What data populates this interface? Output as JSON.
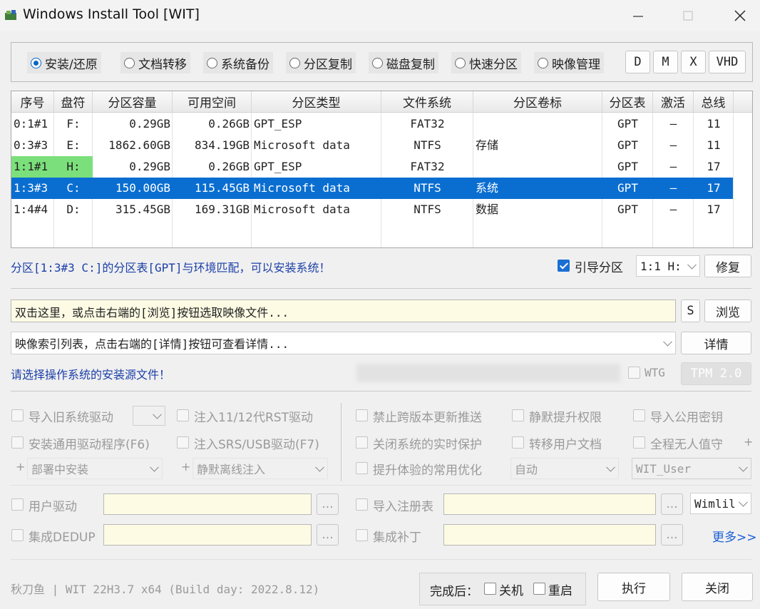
{
  "window": {
    "title": "Windows Install Tool [WIT]"
  },
  "modes": {
    "options": [
      "安装/还原",
      "文档转移",
      "系统备份",
      "分区复制",
      "磁盘复制",
      "快速分区",
      "映像管理"
    ],
    "selected": "安装/还原",
    "drive_buttons": [
      "D",
      "M",
      "X",
      "VHD"
    ]
  },
  "table": {
    "headers": [
      "序号",
      "盘符",
      "分区容量",
      "可用空间",
      "分区类型",
      "文件系统",
      "分区卷标",
      "分区表",
      "激活",
      "总线"
    ],
    "rows": [
      {
        "id": "0:1#1",
        "drive": "F:",
        "size": "0.29GB",
        "free": "0.26GB",
        "type": "GPT_ESP",
        "fs": "FAT32",
        "label": "",
        "table": "GPT",
        "active": "–",
        "bus": "11"
      },
      {
        "id": "0:3#3",
        "drive": "E:",
        "size": "1862.60GB",
        "free": "834.19GB",
        "type": "Microsoft data",
        "fs": "NTFS",
        "label": "存储",
        "table": "GPT",
        "active": "–",
        "bus": "11"
      },
      {
        "id": "1:1#1",
        "drive": "H:",
        "size": "0.29GB",
        "free": "0.26GB",
        "type": "GPT_ESP",
        "fs": "FAT32",
        "label": "",
        "table": "GPT",
        "active": "–",
        "bus": "17"
      },
      {
        "id": "1:3#3",
        "drive": "C:",
        "size": "150.00GB",
        "free": "115.45GB",
        "type": "Microsoft data",
        "fs": "NTFS",
        "label": "系统",
        "table": "GPT",
        "active": "–",
        "bus": "17"
      },
      {
        "id": "1:4#4",
        "drive": "D:",
        "size": "315.45GB",
        "free": "169.31GB",
        "type": "Microsoft data",
        "fs": "NTFS",
        "label": "数据",
        "table": "GPT",
        "active": "–",
        "bus": "17"
      }
    ],
    "selected_index": 3,
    "highlight_index": 2
  },
  "status": {
    "partition_msg": "分区[1:3#3 C:]的分区表[GPT]与环境匹配，可以安装系统！",
    "boot_label": "引导分区",
    "boot_checked": true,
    "boot_select": "1:1 H:",
    "repair_button": "修复"
  },
  "image": {
    "file_placeholder": "双击这里，或点击右端的[浏览]按钮选取映像文件...",
    "s_button": "S",
    "browse_button": "浏览",
    "index_placeholder": "映像索引列表，点击右端的[详情]按钮可查看详情...",
    "detail_button": "详情",
    "source_msg": "请选择操作系统的安装源文件！",
    "wtg_label": "WTG",
    "tpm_button": "TPM 2.0"
  },
  "options": {
    "left": [
      {
        "label": "导入旧系统驱动"
      },
      {
        "label": "注入11/12代RST驱动"
      },
      {
        "label": "安装通用驱动程序(F6)"
      },
      {
        "label": "注入SRS/USB驱动(F7)"
      }
    ],
    "deploy_select": "部署中安装",
    "offline_select": "静默离线注入",
    "right": [
      {
        "label": "禁止跨版本更新推送"
      },
      {
        "label": "静默提升权限"
      },
      {
        "label": "导入公用密钥"
      },
      {
        "label": "关闭系统的实时保护"
      },
      {
        "label": "转移用户文档"
      },
      {
        "label": "全程无人值守"
      },
      {
        "label": "提升体验的常用优化"
      }
    ],
    "auto_select": "自动",
    "user_select": "WIT_User",
    "plus": "+"
  },
  "extras": {
    "user_driver": "用户驱动",
    "integrate_dedup": "集成DEDUP",
    "import_registry": "导入注册表",
    "integrate_patch": "集成补丁",
    "dots": "...",
    "wimlib_select": "Wimlil",
    "more_link": "更多>>"
  },
  "footer": {
    "version": "秋刀鱼 | WIT 22H3.7 x64 (Build day: 2022.8.12)",
    "after_label": "完成后：",
    "shutdown": "关机",
    "reboot": "重启",
    "execute": "执行",
    "close": "关闭"
  }
}
